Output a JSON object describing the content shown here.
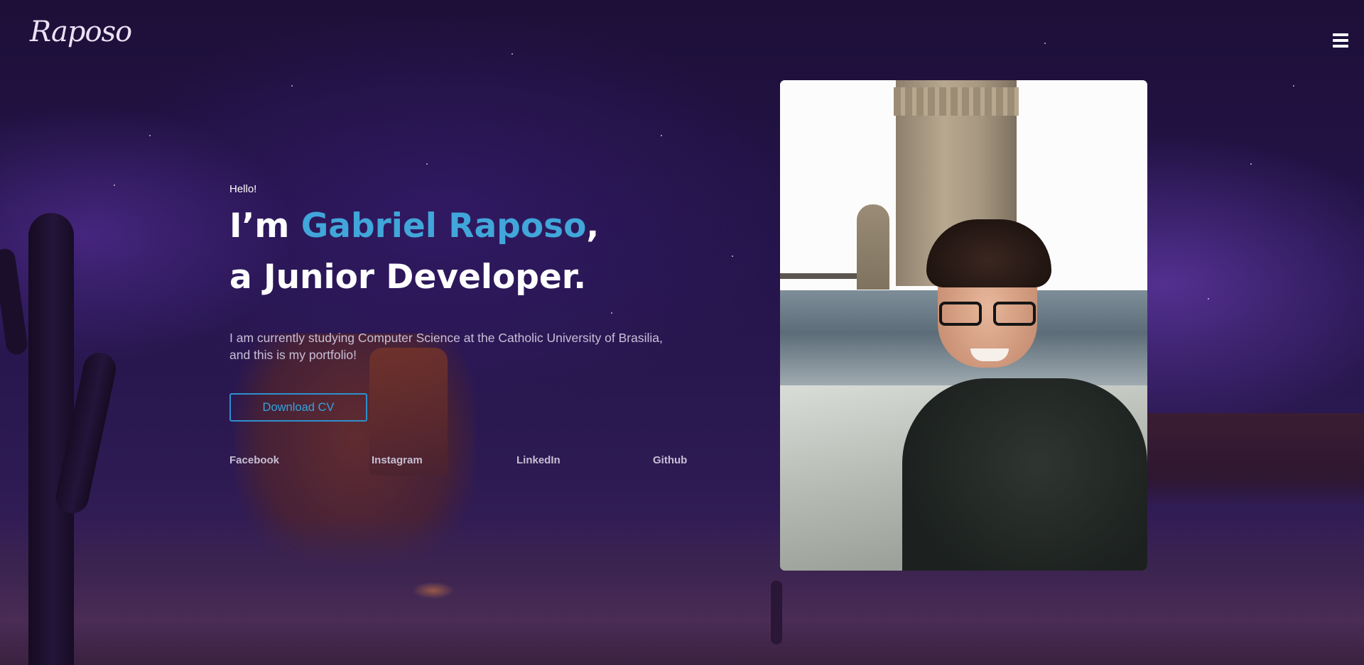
{
  "header": {
    "logo_text": "Raposo",
    "menu_icon": "hamburger-menu-icon"
  },
  "hero": {
    "greeting": "Hello!",
    "headline_prefix": "I’m ",
    "name": "Gabriel Raposo",
    "headline_comma": ",",
    "headline_line2": "a Junior Developer.",
    "intro_line1": "I am currently studying Computer Science at the Catholic University of Brasilia,",
    "intro_line2": "and this is my portfolio!",
    "download_button": "Download CV",
    "accent_color": "#41a6d9"
  },
  "socials": [
    {
      "label": "Facebook"
    },
    {
      "label": "Instagram"
    },
    {
      "label": "LinkedIn"
    },
    {
      "label": "Github"
    }
  ],
  "photo": {
    "subject": "profile-photo"
  }
}
